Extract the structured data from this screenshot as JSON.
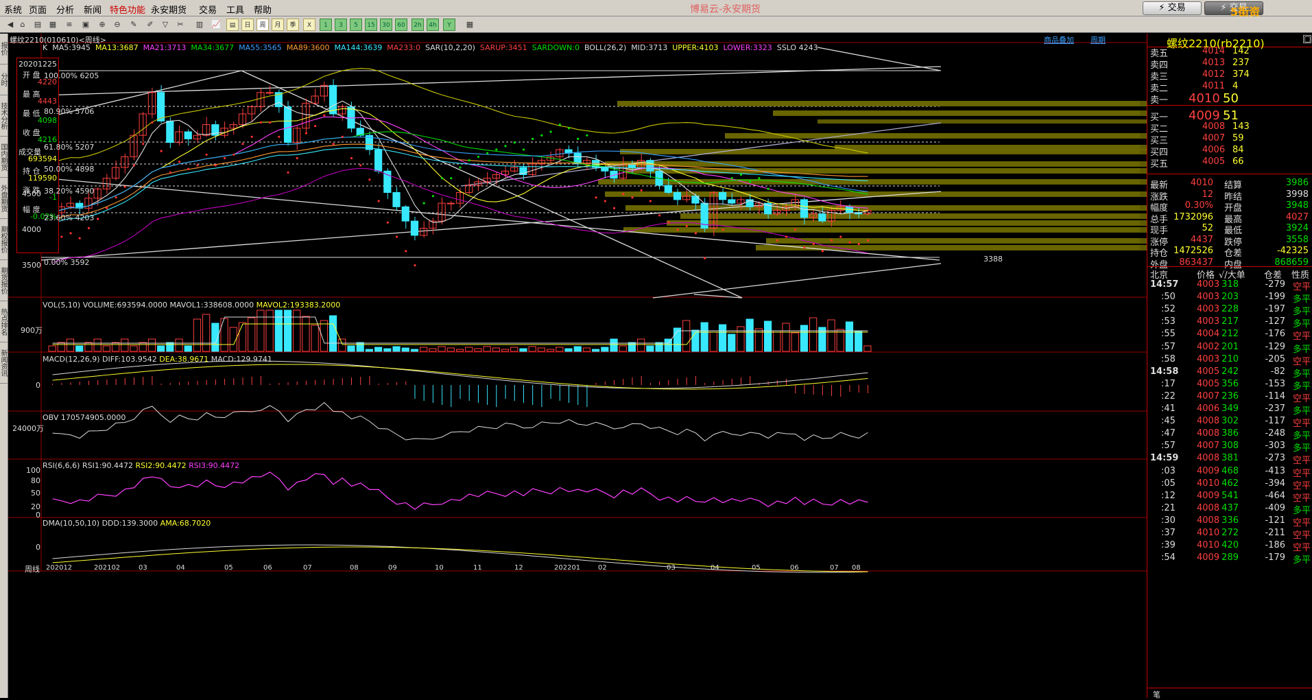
{
  "menu": [
    "系统",
    "页面",
    "分析",
    "新闻",
    "特色功能",
    "永安期货",
    "交易",
    "工具",
    "帮助"
  ],
  "app_title": "博易云-永安期货",
  "trade_label": "⚡ 交易",
  "trade2_label": "⚡ 交易",
  "watermark": "5街资5etz.com",
  "header": {
    "contract": "螺纹2210(010610)<周线>",
    "link1": "商品叠加",
    "link2": "周期"
  },
  "ma_line": {
    "k": "K",
    "ma5": "MA5:3945",
    "ma13": "MA13:3687",
    "ma21": "MA21:3713",
    "ma34": "MA34:3677",
    "ma55": "MA55:3565",
    "ma89": "MA89:3600",
    "ma144": "MA144:3639",
    "ma233": "MA233:0",
    "sar": "SAR(10,2,20)",
    "sarup": "SARUP:3451",
    "sardown": "SARDOWN:0",
    "boll": "BOLL(26,2)",
    "mid": "MID:3713",
    "upper": "UPPER:4103",
    "lower": "LOWER:3323",
    "sslo": "SSLO 4243"
  },
  "info": {
    "date": "20201225",
    "open_l": "开  盘",
    "open": "4220",
    "high_l": "最  高",
    "high": "4443",
    "low_l": "最  低",
    "low": "4098",
    "close_l": "收  盘",
    "close": "4216",
    "vol_l": "成交量",
    "vol": "693594",
    "oi_l": "持  仓",
    "oi": "119590",
    "chg_l": "涨  跌",
    "chg": "-1",
    "amp_l": "幅  度",
    "amp": "-0.02%"
  },
  "fib": [
    "100.00% 6205",
    "80.90% 5706",
    "61.80% 5207",
    "50.00% 4898",
    "38.20% 4590",
    "23.60% 4203",
    "0.00% 3592"
  ],
  "price_ticks": [
    "4500",
    "4000",
    "3500"
  ],
  "low_mark": "3388",
  "vol": {
    "title": "VOL(5,10)",
    "volume": "VOLUME:693594.0000",
    "m1": "MAVOL1:338608.0000",
    "m2": "MAVOL2:193383.2000",
    "tick": "900万"
  },
  "macd": {
    "title": "MACD(12,26,9)",
    "diff": "DIFF:103.9542",
    "dea": "DEA:38.9671",
    "macd": "MACD:129.9741",
    "tick": "0"
  },
  "obv": {
    "title": "OBV",
    "val": "170574905.0000",
    "tick": "24000万"
  },
  "rsi": {
    "title": "RSI(6,6,6)",
    "r1": "RSI1:90.4472",
    "r2": "RSI2:90.4472",
    "r3": "RSI3:90.4472",
    "ticks": [
      "100",
      "80",
      "50",
      "20",
      "0"
    ]
  },
  "dma": {
    "title": "DMA(10,50,10)",
    "ddd": "DDD:139.3000",
    "ama": "AMA:68.7020",
    "tick": "0"
  },
  "xaxis": {
    "label": "周线",
    "ticks": [
      "202012",
      "202102",
      "03",
      "04",
      "05",
      "06",
      "07",
      "08",
      "09",
      "10",
      "11",
      "12",
      "202201",
      "02",
      "03",
      "04",
      "05",
      "06",
      "07",
      "08"
    ]
  },
  "sidetabs": [
    "报价",
    "分时",
    "技术分析",
    "国内期货",
    "外盘期货",
    "期权报价",
    "期货报价",
    "热点排名",
    "新闻资讯"
  ],
  "quote": {
    "title": "螺纹2210(rb2210)",
    "asks": [
      [
        "卖五",
        "4014",
        "142"
      ],
      [
        "卖四",
        "4013",
        "237"
      ],
      [
        "卖三",
        "4012",
        "374"
      ],
      [
        "卖二",
        "4011",
        "4"
      ],
      [
        "卖一",
        "4010",
        "50"
      ]
    ],
    "bids": [
      [
        "买一",
        "4009",
        "51"
      ],
      [
        "买二",
        "4008",
        "143"
      ],
      [
        "买三",
        "4007",
        "59"
      ],
      [
        "买四",
        "4006",
        "84"
      ],
      [
        "买五",
        "4005",
        "66"
      ]
    ],
    "stats": [
      [
        "最新",
        "4010",
        "结算",
        "3986"
      ],
      [
        "涨跌",
        "12",
        "昨结",
        "3998"
      ],
      [
        "幅度",
        "0.30%",
        "开盘",
        "3948"
      ],
      [
        "总手",
        "1732096",
        "最高",
        "4027"
      ],
      [
        "现手",
        "52",
        "最低",
        "3924"
      ],
      [
        "涨停",
        "4437",
        "跌停",
        "3558"
      ],
      [
        "持仓",
        "1472526",
        "仓差",
        "-42325"
      ],
      [
        "外盘",
        "863437",
        "内盘",
        "868659"
      ]
    ],
    "tick_header": [
      "北京",
      "价格",
      "√/大单",
      "仓差",
      "性质"
    ],
    "ticks": [
      [
        "14:57",
        "4003",
        "318",
        "-279",
        "空平"
      ],
      [
        ":50",
        "4003",
        "203",
        "-199",
        "多平"
      ],
      [
        ":52",
        "4003",
        "228",
        "-197",
        "多平"
      ],
      [
        ":53",
        "4003",
        "217",
        "-127",
        "多平"
      ],
      [
        ":55",
        "4004",
        "212",
        "-176",
        "空平"
      ],
      [
        ":57",
        "4002",
        "201",
        "-129",
        "多平"
      ],
      [
        ":58",
        "4003",
        "210",
        "-205",
        "空平"
      ],
      [
        "14:58",
        "4005",
        "242",
        "-82",
        "多平"
      ],
      [
        ":17",
        "4005",
        "356",
        "-153",
        "多平"
      ],
      [
        ":22",
        "4007",
        "236",
        "-114",
        "空平"
      ],
      [
        ":41",
        "4006",
        "349",
        "-237",
        "多平"
      ],
      [
        ":45",
        "4008",
        "302",
        "-117",
        "空平"
      ],
      [
        ":47",
        "4008",
        "386",
        "-248",
        "多平"
      ],
      [
        ":57",
        "4007",
        "308",
        "-303",
        "多平"
      ],
      [
        "14:59",
        "4008",
        "381",
        "-273",
        "空平"
      ],
      [
        ":03",
        "4009",
        "468",
        "-413",
        "空平"
      ],
      [
        ":05",
        "4010",
        "462",
        "-394",
        "空平"
      ],
      [
        ":12",
        "4009",
        "541",
        "-464",
        "空平"
      ],
      [
        ":21",
        "4008",
        "437",
        "-409",
        "多平"
      ],
      [
        ":30",
        "4008",
        "336",
        "-121",
        "空平"
      ],
      [
        ":37",
        "4010",
        "272",
        "-211",
        "空平"
      ],
      [
        ":39",
        "4010",
        "420",
        "-186",
        "空平"
      ],
      [
        ":54",
        "4009",
        "289",
        "-179",
        "多平"
      ]
    ],
    "footer": "笔"
  },
  "colors": {
    "up": "#ff4040",
    "down": "#38e8ff",
    "grid": "#800000",
    "bg": "#000000"
  }
}
